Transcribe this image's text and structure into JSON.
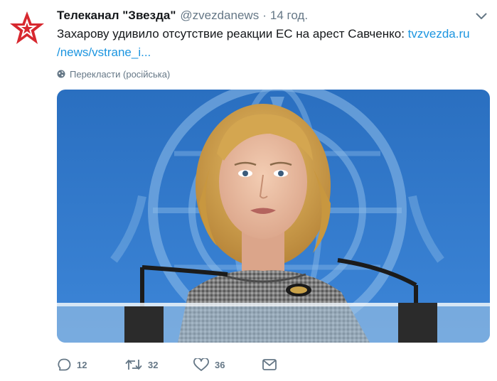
{
  "tweet": {
    "display_name": "Телеканал \"Звезда\"",
    "handle": "@zvezdanews",
    "separator": "·",
    "time": "14 год.",
    "text": "Захарову удивило отсутствие реакции ЕС на арест Савченко: ",
    "link_line1": "tvzvezda.ru",
    "link_line2": "/news/vstrane_i...",
    "translate_label": "Перекласти (російська)",
    "avatar_icon": "zvezda-red-star-logo",
    "menu_icon": "chevron-down-icon",
    "translate_icon": "globe-icon"
  },
  "actions": {
    "reply_count": "12",
    "retweet_count": "32",
    "like_count": "36",
    "reply_icon": "reply-icon",
    "retweet_icon": "retweet-icon",
    "like_icon": "heart-icon",
    "dm_icon": "envelope-icon"
  },
  "colors": {
    "link": "#1b95e0",
    "text": "#14171a",
    "secondary": "#657786",
    "brand_red": "#d7282f"
  }
}
